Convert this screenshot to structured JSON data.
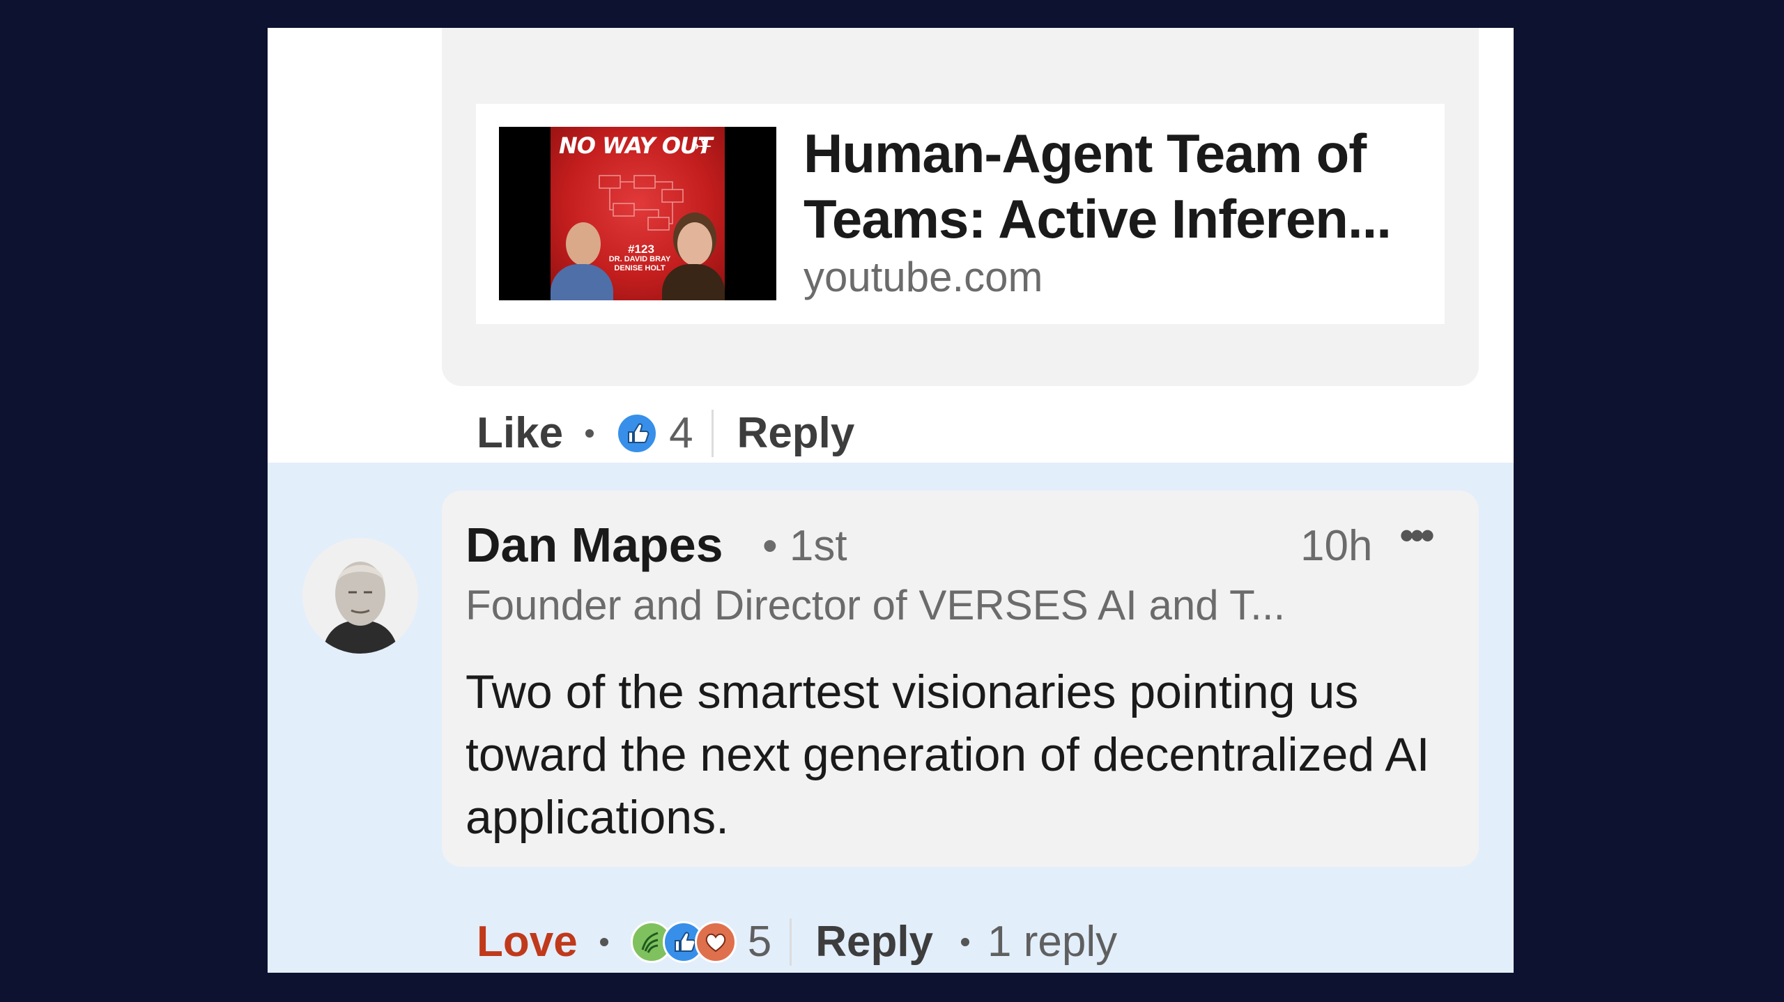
{
  "link_preview": {
    "thumbnail": {
      "title": "NO WAY OUT",
      "episode": "#123",
      "names": [
        "DR. DAVID BRAY",
        "DENISE HOLT"
      ]
    },
    "title_line1": "Human-Agent Team of",
    "title_line2": "Teams: Active Inferen...",
    "domain": "youtube.com"
  },
  "comment1_actions": {
    "like_label": "Like",
    "reaction_icon": "like-icon",
    "reaction_count": "4",
    "reply_label": "Reply"
  },
  "comment2": {
    "author": "Dan Mapes",
    "degree": "• 1st",
    "time": "10h",
    "more": "•••",
    "headline": "Founder and Director of VERSES AI and T...",
    "text": "Two of the smartest visionaries pointing us toward the next generation of decentralized AI applications.",
    "actions": {
      "reaction_label": "Love",
      "reaction_icons": [
        "support-icon",
        "like-icon",
        "love-icon"
      ],
      "reaction_count": "5",
      "reply_label": "Reply",
      "replies": "1 reply"
    }
  },
  "colors": {
    "background": "#0c1230",
    "highlight_row": "#e3eefb",
    "love_text": "#c0391b",
    "like_blue": "#378fe9"
  }
}
